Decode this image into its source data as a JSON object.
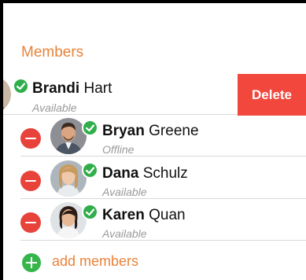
{
  "section": {
    "title": "Members"
  },
  "members": [
    {
      "first": "Brandi",
      "last": "Hart",
      "status": "Available",
      "action": "Delete"
    },
    {
      "first": "Bryan",
      "last": "Greene",
      "status": "Offline"
    },
    {
      "first": "Dana",
      "last": "Schulz",
      "status": "Available"
    },
    {
      "first": "Karen",
      "last": "Quan",
      "status": "Available"
    }
  ],
  "add_members": {
    "label": "add members"
  },
  "colors": {
    "accent": "#e8833a",
    "delete": "#f2473d",
    "remove": "#e8433a",
    "online": "#2fae4a"
  },
  "icons": [
    "check-icon",
    "remove-circle-icon",
    "add-circle-icon"
  ]
}
